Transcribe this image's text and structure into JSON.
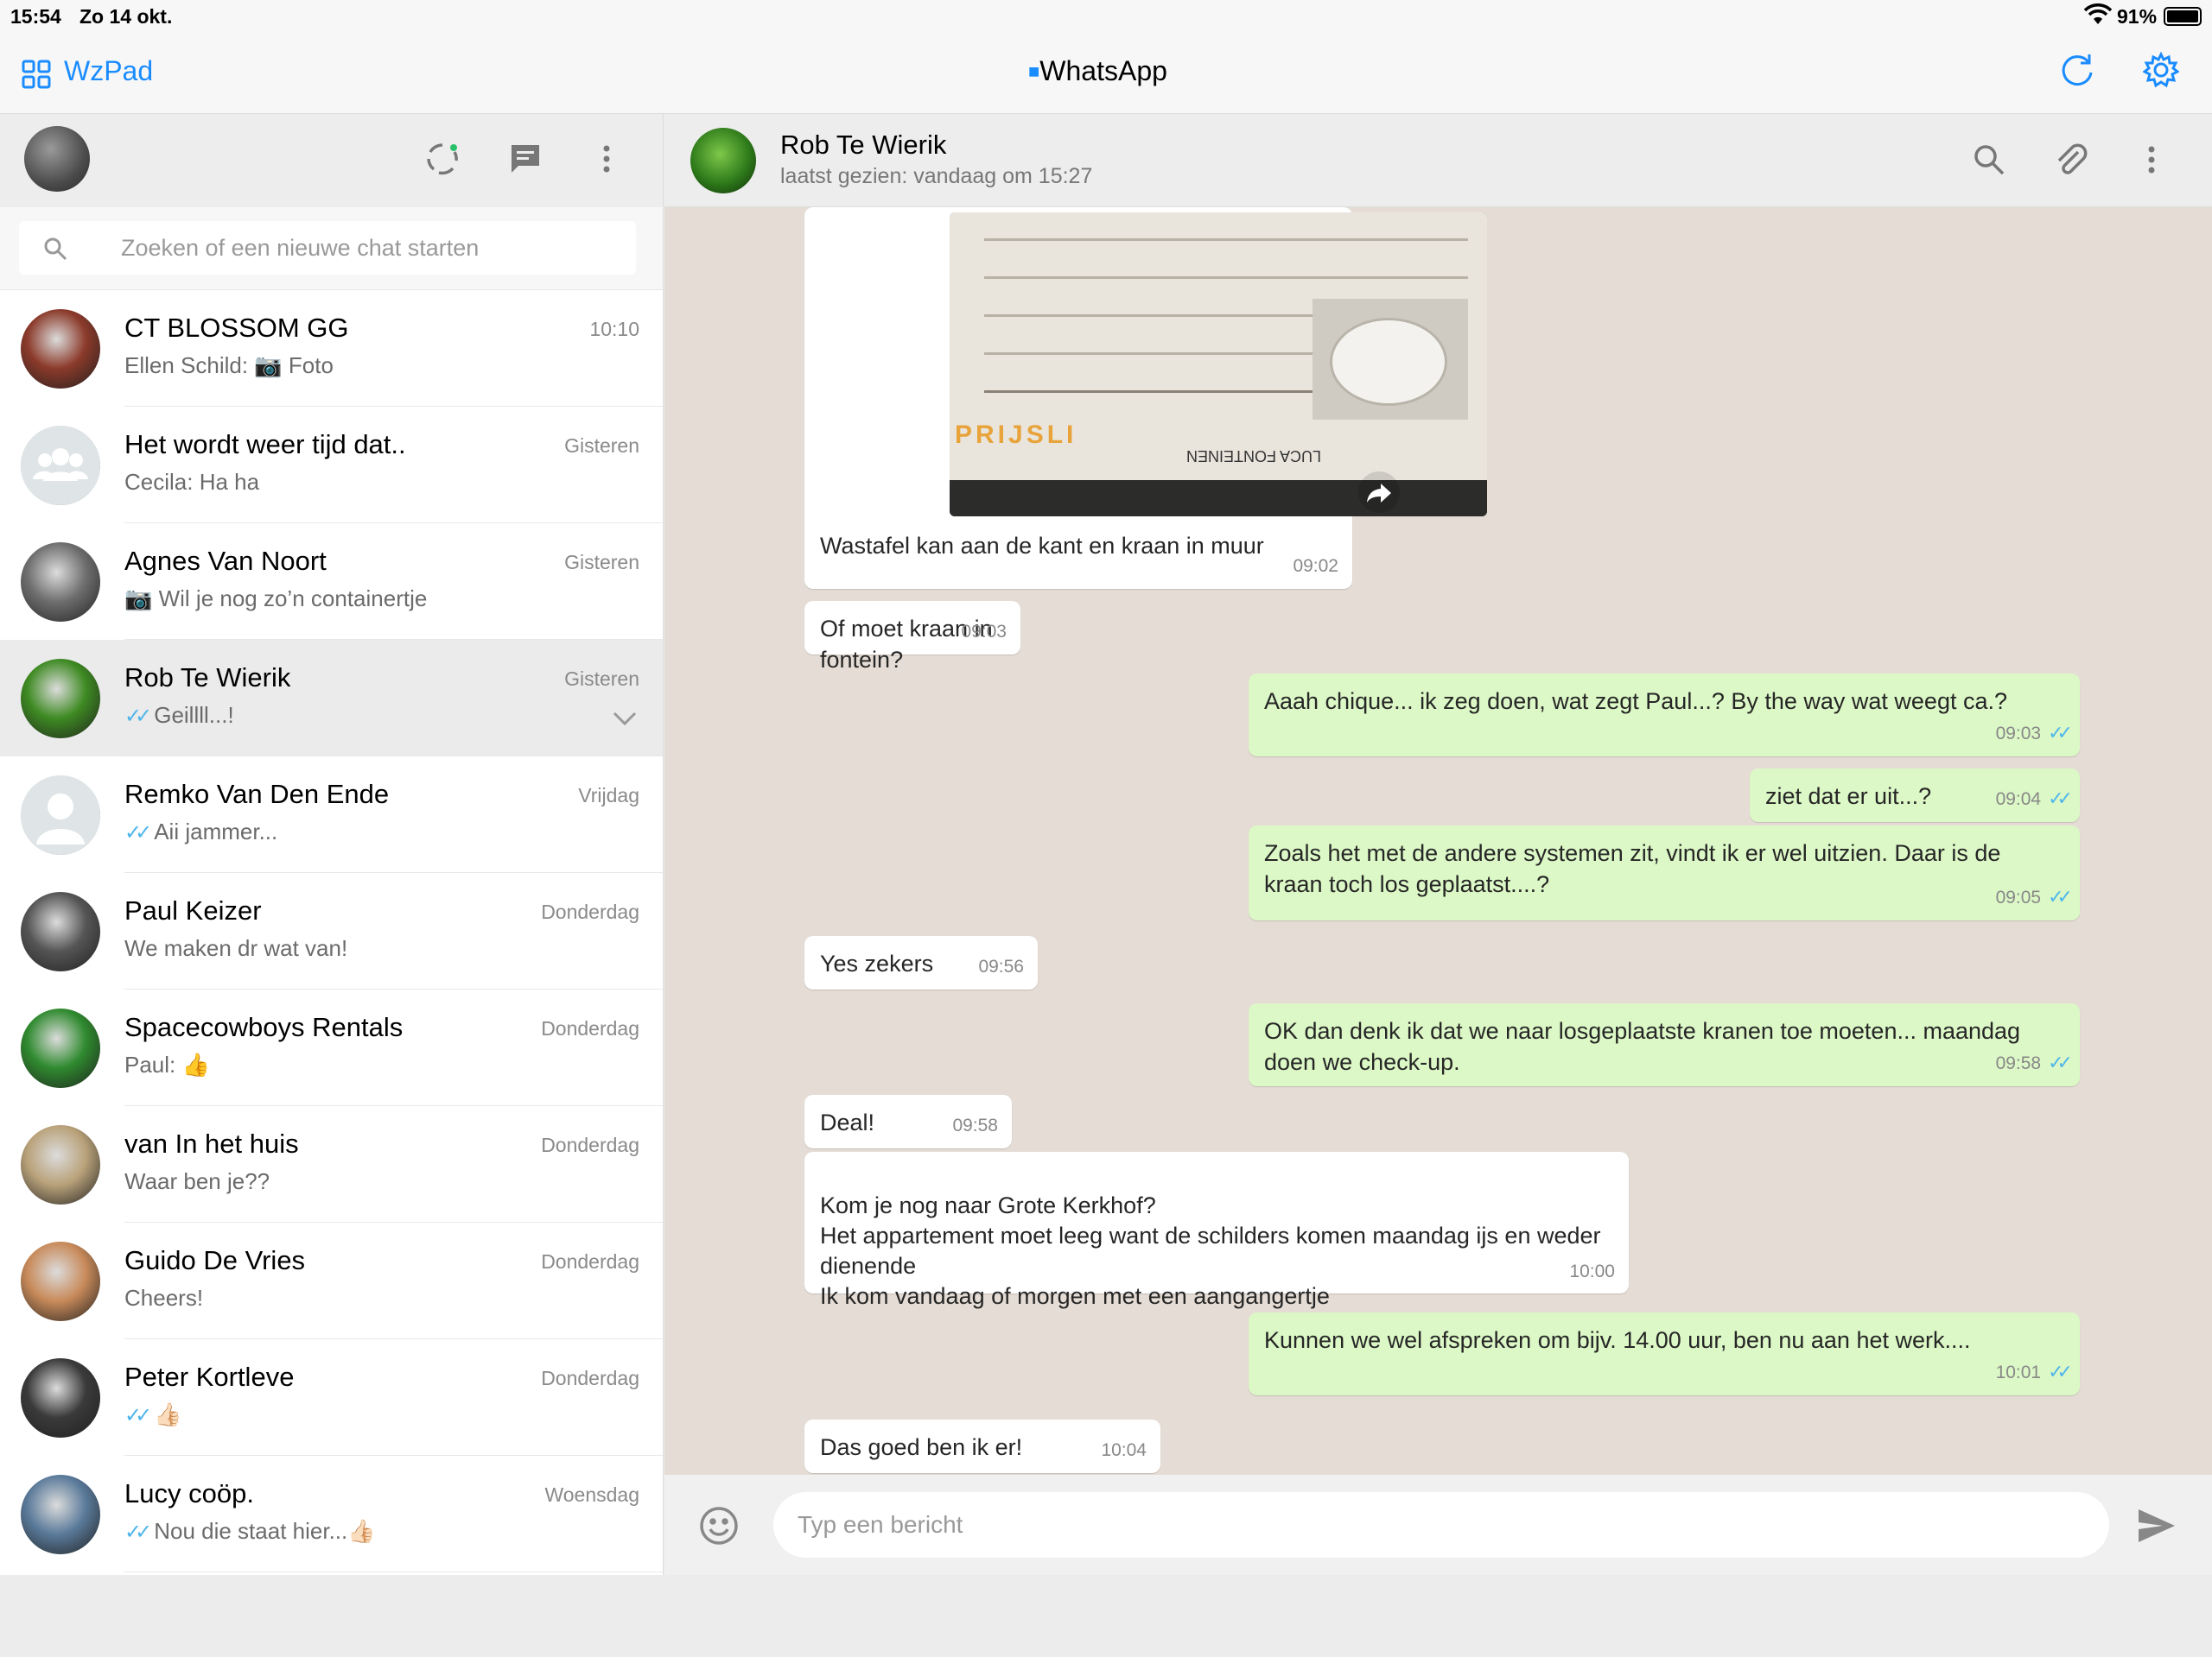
{
  "status_bar": {
    "time": "15:54",
    "date": "Zo 14 okt.",
    "battery": "91%",
    "wifi_icon": "wifi-icon"
  },
  "top_bar": {
    "app_name": "WzPad",
    "title": "WhatsApp",
    "lock_icon": "🔒"
  },
  "search": {
    "placeholder": "Zoeken of een nieuwe chat starten"
  },
  "chats": [
    {
      "name": "CT BLOSSOM GG",
      "time": "10:10",
      "preview": "Ellen Schild: 📷 Foto",
      "avatar_color": "#8b3a2a"
    },
    {
      "name": "Het wordt weer tijd dat..",
      "time": "Gisteren",
      "preview": "Cecila: Ha ha",
      "avatar_color": "#dfe5e7"
    },
    {
      "name": "Agnes Van Noort",
      "time": "Gisteren",
      "preview": "📷 Wil je nog zo’n containertje",
      "avatar_color": "#6e6e6e"
    },
    {
      "name": "Rob Te Wierik",
      "time": "Gisteren",
      "preview": "Geillll...!",
      "ticks": true,
      "avatar_color": "#3e8a22"
    },
    {
      "name": "Remko Van Den Ende",
      "time": "Vrijdag",
      "preview": "Aii jammer...",
      "ticks": true,
      "avatar_color": "#dfe5e7"
    },
    {
      "name": "Paul Keizer",
      "time": "Donderdag",
      "preview": "We maken dr wat van!",
      "avatar_color": "#555555"
    },
    {
      "name": "Spacecowboys Rentals",
      "time": "Donderdag",
      "preview": "Paul: 👍",
      "avatar_color": "#2f8a2f"
    },
    {
      "name": "van In het huis",
      "time": "Donderdag",
      "preview": "Waar ben je??",
      "avatar_color": "#b9a27a"
    },
    {
      "name": "Guido De Vries",
      "time": "Donderdag",
      "preview": "Cheers!",
      "avatar_color": "#c88a5a"
    },
    {
      "name": "Peter Kortleve",
      "time": "Donderdag",
      "preview": "👍🏻",
      "ticks": true,
      "avatar_color": "#3a3a3a"
    },
    {
      "name": "Lucy coöp.",
      "time": "Woensdag",
      "preview": "Nou die staat hier...👍🏻",
      "ticks": true,
      "avatar_color": "#5a7a9a"
    }
  ],
  "conversation": {
    "name": "Rob Te Wierik",
    "status": "laatst gezien: vandaag om 15:27",
    "photo_text": {
      "prijslijst": "PRIJSLI",
      "luca": "LUCA FONTEINEN"
    },
    "messages": [
      {
        "dir": "in",
        "text": "Wastafel kan aan de kant en kraan in muur",
        "time": "09:02"
      },
      {
        "dir": "in",
        "text": "Of moet kraan in fontein?",
        "time": "09:03"
      },
      {
        "dir": "out",
        "text": "Aaah chique... ik zeg doen, wat zegt Paul...? By the way wat weegt ca.?",
        "time": "09:03"
      },
      {
        "dir": "out",
        "text": "ziet dat er uit...?",
        "time": "09:04"
      },
      {
        "dir": "out",
        "text": "Zoals het met de andere systemen zit, vindt ik er wel uitzien. Daar is de kraan toch los geplaatst....?",
        "time": "09:05"
      },
      {
        "dir": "in",
        "text": "Yes zekers",
        "time": "09:56"
      },
      {
        "dir": "out",
        "text": "OK dan denk ik dat we naar losgeplaatste kranen toe moeten... maandag doen we check-up.",
        "time": "09:58"
      },
      {
        "dir": "in",
        "text": "Deal!",
        "time": "09:58"
      },
      {
        "dir": "in",
        "text": "Kom je nog naar Grote Kerkhof?\nHet appartement moet leeg want de schilders komen maandag ijs en weder dienende\nIk kom vandaag of morgen met een aangangertje",
        "time": "10:00"
      },
      {
        "dir": "out",
        "text": "Kunnen we wel afspreken om bijv. 14.00 uur, ben nu aan het werk....",
        "time": "10:01"
      },
      {
        "dir": "in",
        "text": "Das goed ben ik er!",
        "time": "10:04"
      }
    ]
  },
  "composer": {
    "placeholder": "Typ een bericht"
  },
  "colors": {
    "accent": "#1a8cff",
    "outgoing": "#dcf8c6",
    "incoming": "#ffffff",
    "chat_bg": "#e5ddd5",
    "tick": "#4fb6ec"
  }
}
